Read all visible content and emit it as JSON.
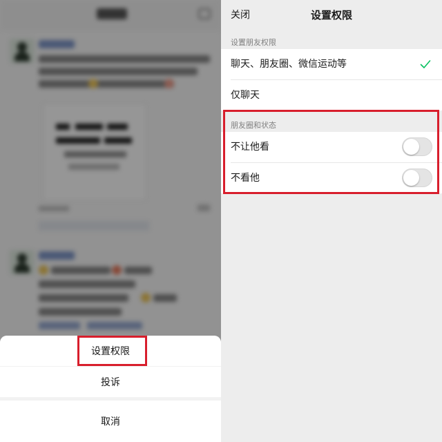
{
  "action_sheet": {
    "set_permission": "设置权限",
    "report": "投诉",
    "cancel": "取消"
  },
  "settings": {
    "nav": {
      "close": "关闭",
      "title": "设置权限"
    },
    "friend_permission": {
      "label": "设置朋友权限",
      "options": [
        {
          "label": "聊天、朋友圈、微信运动等",
          "selected": true
        },
        {
          "label": "仅聊天",
          "selected": false
        }
      ]
    },
    "moments": {
      "label": "朋友圈和状态",
      "toggles": [
        {
          "label": "不让他看",
          "on": false
        },
        {
          "label": "不看他",
          "on": false
        }
      ]
    }
  },
  "colors": {
    "highlight": "#d81e2c",
    "check": "#07c160",
    "background": "#ededed"
  }
}
